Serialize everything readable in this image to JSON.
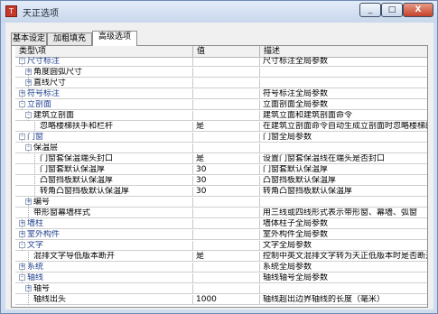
{
  "window": {
    "title": "天正选项",
    "min_label": "_",
    "max_label": "□",
    "close_label": "X"
  },
  "tabs": [
    {
      "label": "基本设定"
    },
    {
      "label": "加粗填充"
    },
    {
      "label": "高级选项"
    }
  ],
  "grid": {
    "headers": {
      "type": "类型\\项",
      "value": "值",
      "desc": "描述"
    },
    "rows": [
      {
        "indent": 0,
        "toggle": "-",
        "label": "尺寸标注",
        "value": "",
        "desc": "尺寸标注全局参数"
      },
      {
        "indent": 1,
        "toggle": "+",
        "label": "角度圆弧尺寸",
        "value": "",
        "desc": ""
      },
      {
        "indent": 1,
        "toggle": "+",
        "label": "直线尺寸",
        "value": "",
        "desc": ""
      },
      {
        "indent": 0,
        "toggle": "+",
        "label": "符号标注",
        "value": "",
        "desc": "符号标注全局参数"
      },
      {
        "indent": 0,
        "toggle": "-",
        "label": "立剖面",
        "value": "",
        "desc": "立面剖面全局参数"
      },
      {
        "indent": 1,
        "toggle": "-",
        "label": "建筑立剖面",
        "value": "",
        "desc": "建筑立面和建筑剖面命令"
      },
      {
        "indent": 2,
        "toggle": "",
        "label": "忽略楼梯扶手和栏杆",
        "value": "是",
        "desc": "在建筑立剖面命令自动生成立剖面时忽略楼梯的扶"
      },
      {
        "indent": 0,
        "toggle": "-",
        "label": "门窗",
        "value": "",
        "desc": "门窗全局参数"
      },
      {
        "indent": 1,
        "toggle": "-",
        "label": "保温层",
        "value": "",
        "desc": ""
      },
      {
        "indent": 2,
        "toggle": "",
        "label": "门窗套保温端头封口",
        "value": "是",
        "desc": "设置门窗套保温线在端头是否封口"
      },
      {
        "indent": 2,
        "toggle": "",
        "label": "门窗套默认保温厚",
        "value": "30",
        "desc": "门窗套默认保温厚"
      },
      {
        "indent": 2,
        "toggle": "",
        "label": "凸窗挡板默认保温厚",
        "value": "30",
        "desc": "凸窗挡板默认保温厚"
      },
      {
        "indent": 2,
        "toggle": "",
        "label": "转角凸窗挡板默认保温厚",
        "value": "30",
        "desc": "转角凸窗挡板默认保温厚"
      },
      {
        "indent": 1,
        "toggle": "+",
        "label": "编号",
        "value": "",
        "desc": ""
      },
      {
        "indent": 1,
        "toggle": "",
        "label": "带形窗幕墙样式",
        "value": "",
        "desc": "用三线或四线形式表示带形窗、幕墙、弧窗"
      },
      {
        "indent": 0,
        "toggle": "+",
        "label": "墙柱",
        "value": "",
        "desc": "墙体柱子全局参数"
      },
      {
        "indent": 0,
        "toggle": "+",
        "label": "室外构件",
        "value": "",
        "desc": "室外构件全局参数"
      },
      {
        "indent": 0,
        "toggle": "-",
        "label": "文字",
        "value": "",
        "desc": "文字全局参数"
      },
      {
        "indent": 1,
        "toggle": "",
        "label": "混排文字导低版本断开",
        "value": "是",
        "desc": "控制中英文混排文字转为天正低版本时是否断开"
      },
      {
        "indent": 0,
        "toggle": "+",
        "label": "系统",
        "value": "",
        "desc": "系统全局参数"
      },
      {
        "indent": 0,
        "toggle": "-",
        "label": "轴线",
        "value": "",
        "desc": "轴线轴号全局参数"
      },
      {
        "indent": 1,
        "toggle": "+",
        "label": "轴号",
        "value": "",
        "desc": ""
      },
      {
        "indent": 1,
        "toggle": "",
        "label": "轴线出头",
        "value": "1000",
        "desc": "轴线超出边界轴线的长度（毫米）"
      }
    ]
  }
}
